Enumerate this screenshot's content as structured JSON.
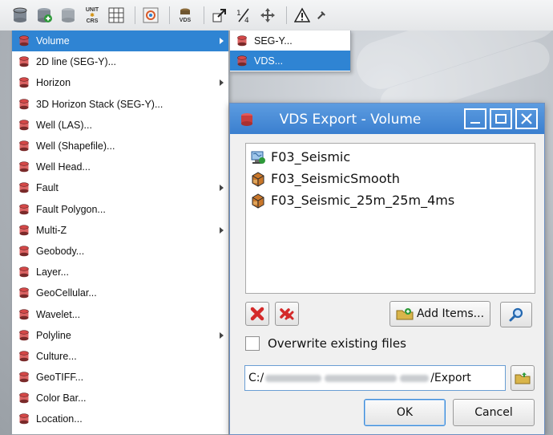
{
  "toolbar": {
    "unit_label_top": "UNIT",
    "unit_label_bottom": "CRS",
    "vds_label": "VDS"
  },
  "menu": {
    "items": [
      {
        "label": "Volume",
        "submenu": true,
        "active": true
      },
      {
        "label": "2D line (SEG-Y)..."
      },
      {
        "label": "Horizon",
        "submenu": true
      },
      {
        "label": "3D Horizon Stack (SEG-Y)..."
      },
      {
        "label": "Well (LAS)..."
      },
      {
        "label": "Well (Shapefile)..."
      },
      {
        "label": "Well Head..."
      },
      {
        "label": "Fault",
        "submenu": true
      },
      {
        "label": "Fault Polygon..."
      },
      {
        "label": "Multi-Z",
        "submenu": true
      },
      {
        "label": "Geobody..."
      },
      {
        "label": "Layer..."
      },
      {
        "label": "GeoCellular..."
      },
      {
        "label": "Wavelet..."
      },
      {
        "label": "Polyline",
        "submenu": true
      },
      {
        "label": "Culture..."
      },
      {
        "label": "GeoTIFF..."
      },
      {
        "label": "Color Bar..."
      },
      {
        "label": "Location..."
      }
    ]
  },
  "submenu": {
    "items": [
      {
        "label": "SEG-Y..."
      },
      {
        "label": "VDS...",
        "active": true
      }
    ]
  },
  "dialog": {
    "title": "VDS Export - Volume",
    "list": [
      {
        "label": "F03_Seismic",
        "icon": "seismic-volume-icon"
      },
      {
        "label": "F03_SeismicSmooth",
        "icon": "volume-cube-icon"
      },
      {
        "label": "F03_Seismic_25m_25m_4ms",
        "icon": "volume-cube-icon"
      }
    ],
    "add_items_label": "Add Items...",
    "overwrite_label": "Overwrite existing files",
    "path_prefix": "C:/",
    "path_suffix": "/Export",
    "ok_label": "OK",
    "cancel_label": "Cancel"
  },
  "colors": {
    "accent": "#2f84d3",
    "titlebar": "#4a8dd8",
    "delete_red": "#d42a2a"
  }
}
